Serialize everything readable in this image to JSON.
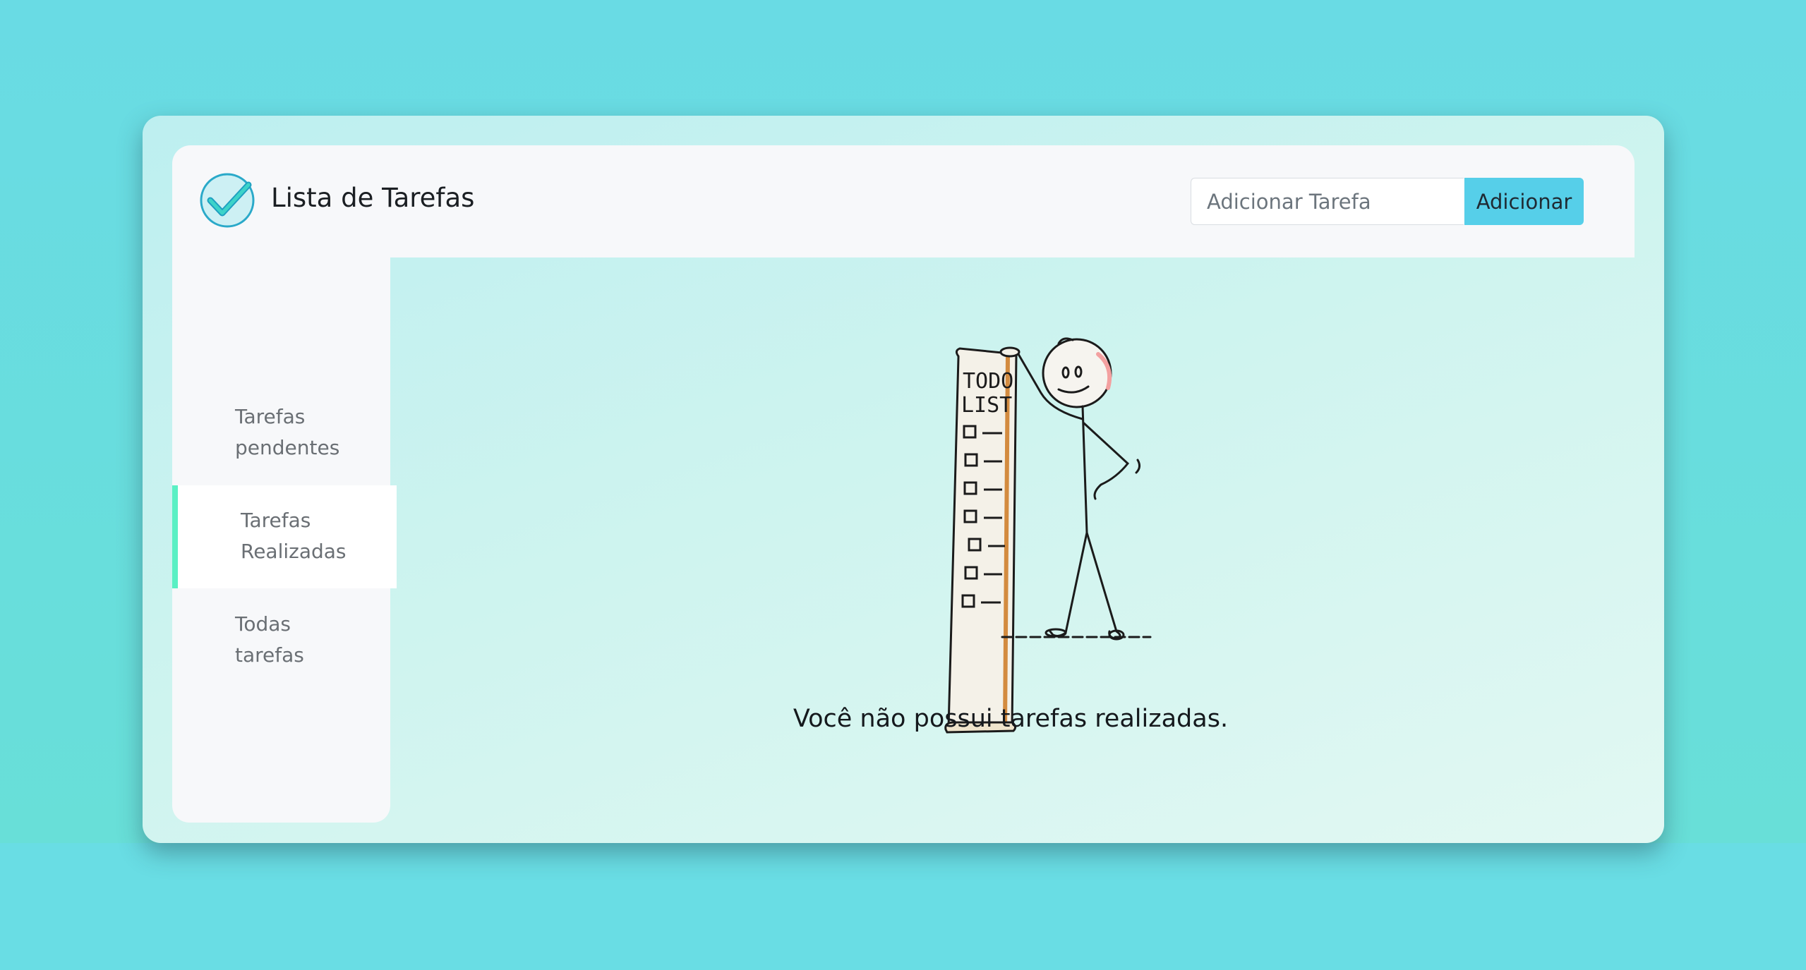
{
  "app": {
    "title": "Lista de Tarefas",
    "logo_icon": "check-circle-icon"
  },
  "add_task": {
    "placeholder": "Adicionar Tarefa",
    "value": "",
    "button_label": "Adicionar"
  },
  "sidebar": {
    "items": [
      {
        "label": "Tarefas pendentes",
        "active": false
      },
      {
        "label": "Tarefas Realizadas",
        "active": true
      },
      {
        "label": "Todas tarefas",
        "active": false
      }
    ]
  },
  "main": {
    "illustration_text": [
      "TODO",
      "LIST"
    ],
    "empty_message": "Você não possui tarefas realizadas."
  },
  "colors": {
    "accent": "#56cfe9",
    "active_indicator": "#5af0c4",
    "background": "#69dde4"
  }
}
